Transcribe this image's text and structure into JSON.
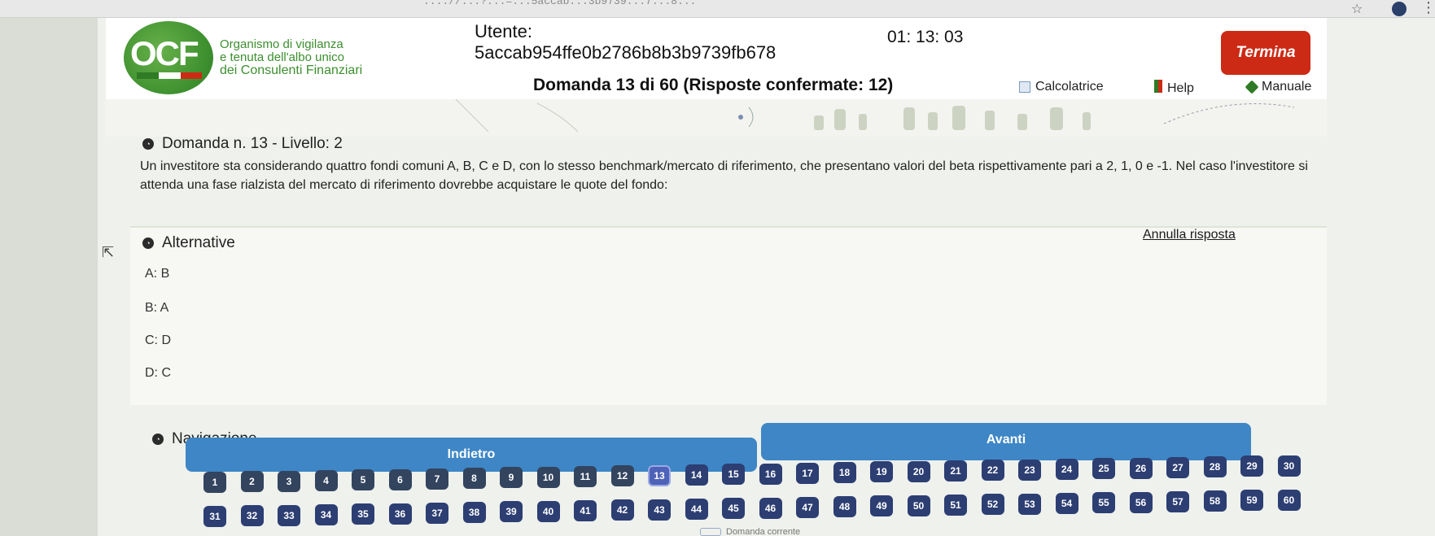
{
  "browser": {
    "url_fragment": "...://...?...=...5accab...3b9739...7...8...",
    "star_icon": "star-icon"
  },
  "header": {
    "logo_text": "OCF",
    "org_lines": [
      "Organismo di vigilanza",
      "e tenuta dell'albo unico",
      "dei Consulenti Finanziari"
    ],
    "user_label": "Utente:",
    "user_id": "5accab954ffe0b2786b8b3b9739fb678",
    "timer": "01: 13: 03",
    "termina_label": "Termina",
    "question_counter": "Domanda 13 di 60 (Risposte confermate: 12)",
    "tools": {
      "calc": "Calcolatrice",
      "help": "Help",
      "manual": "Manuale"
    },
    "colors": {
      "green": "#3c8f2e",
      "red": "#cc2a15"
    }
  },
  "question": {
    "title": "Domanda n. 13 - Livello: 2",
    "text": "Un investitore sta considerando quattro fondi comuni A, B, C e D, con lo stesso benchmark/mercato di riferimento, che presentano valori del beta rispettivamente pari a 2, 1, 0 e -1. Nel caso l'investitore si attenda una fase rialzista del mercato di riferimento dovrebbe acquistare le quote del fondo:"
  },
  "alternatives": {
    "title": "Alternative",
    "annulla": "Annulla risposta",
    "items": [
      "A: B",
      "B: A",
      "C: D",
      "D: C"
    ]
  },
  "navigation": {
    "title": "Navigazione",
    "avanti": "Avanti",
    "indietro": "Indietro",
    "current_question": 13,
    "total_questions": 60,
    "confirmed": 12,
    "legend_current": "Domanda corrente"
  }
}
